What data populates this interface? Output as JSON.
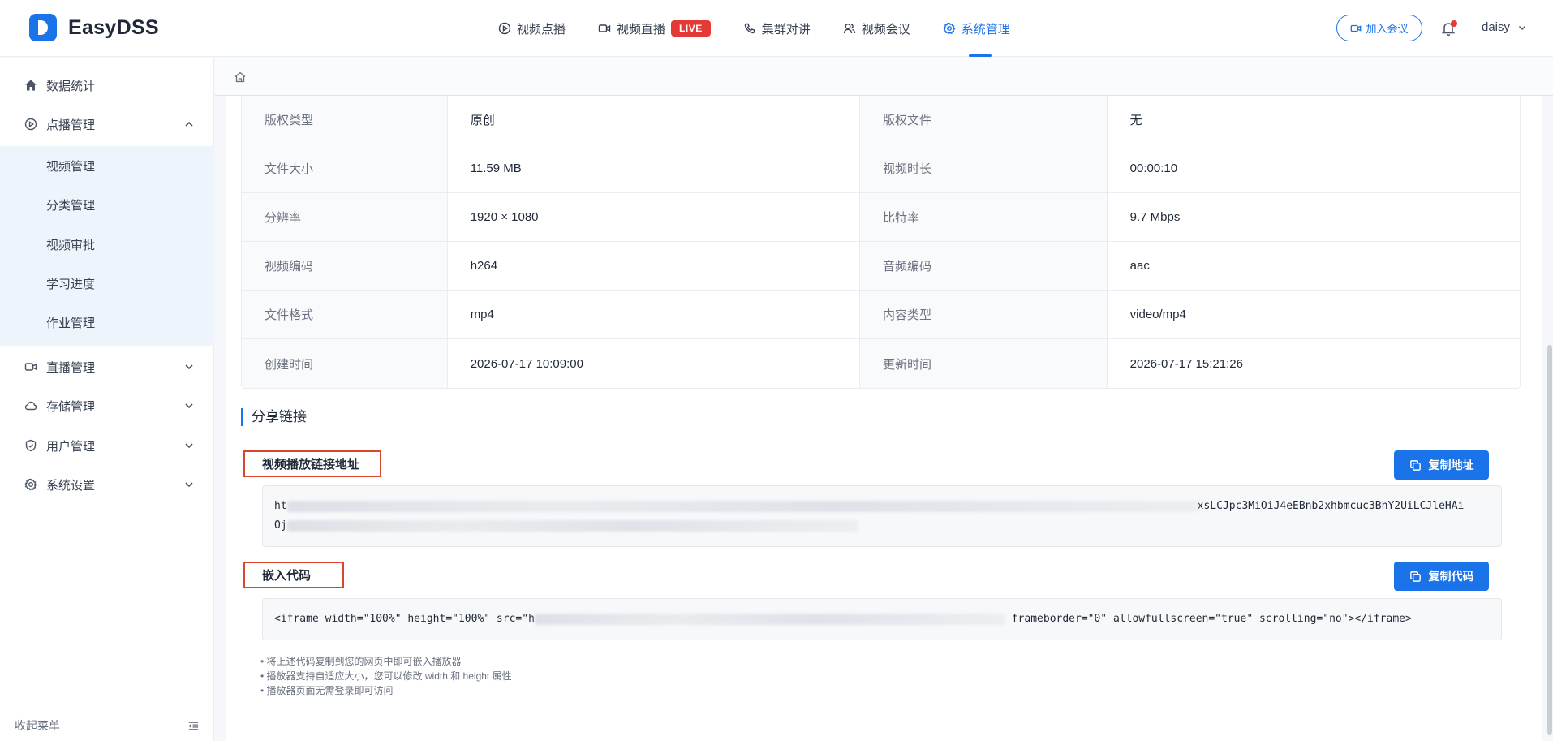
{
  "app": {
    "name": "EasyDSS"
  },
  "nav": [
    {
      "label": "视频点播",
      "icon": "play-circle-icon"
    },
    {
      "label": "视频直播",
      "icon": "video-camera-icon",
      "badge": "LIVE"
    },
    {
      "label": "集群对讲",
      "icon": "phone-icon"
    },
    {
      "label": "视频会议",
      "icon": "users-icon"
    },
    {
      "label": "系统管理",
      "icon": "gear-icon",
      "active": true
    }
  ],
  "header": {
    "join_label": "加入会议",
    "user": "daisy"
  },
  "sidebar": {
    "items": [
      {
        "label": "数据统计",
        "icon": "home-icon"
      },
      {
        "label": "点播管理",
        "icon": "play-circle-icon",
        "expanded": true
      },
      {
        "label": "直播管理",
        "icon": "video-camera-icon"
      },
      {
        "label": "存储管理",
        "icon": "cloud-icon"
      },
      {
        "label": "用户管理",
        "icon": "shield-icon"
      },
      {
        "label": "系统设置",
        "icon": "gear-icon"
      }
    ],
    "subitems": [
      "视频管理",
      "分类管理",
      "视频审批",
      "学习进度",
      "作业管理"
    ],
    "collapse_label": "收起菜单"
  },
  "info": {
    "rows": [
      {
        "l1": "版权类型",
        "v1": "原创",
        "l2": "版权文件",
        "v2": "无"
      },
      {
        "l1": "文件大小",
        "v1": "11.59 MB",
        "l2": "视频时长",
        "v2": "00:00:10"
      },
      {
        "l1": "分辨率",
        "v1": "1920 × 1080",
        "l2": "比特率",
        "v2": "9.7 Mbps"
      },
      {
        "l1": "视频编码",
        "v1": "h264",
        "l2": "音频编码",
        "v2": "aac"
      },
      {
        "l1": "文件格式",
        "v1": "mp4",
        "l2": "内容类型",
        "v2": "video/mp4"
      },
      {
        "l1": "创建时间",
        "v1": "2026-07-17 10:09:00",
        "l2": "更新时间",
        "v2": "2026-07-17 15:21:26"
      }
    ]
  },
  "share": {
    "title": "分享链接",
    "link": {
      "label": "视频播放链接地址",
      "copy_label": "复制地址",
      "line1_start": "ht",
      "line1_end": "xsLCJpc3MiOiJ4eEBnb2xhbmcuc3BhY2UiLCJleHAi",
      "line2_start": "Oj"
    },
    "embed": {
      "label": "嵌入代码",
      "copy_label": "复制代码",
      "code_start": "<iframe width=\"100%\" height=\"100%\" src=\"h",
      "code_end": " frameborder=\"0\" allowfullscreen=\"true\" scrolling=\"no\"></iframe>"
    },
    "notes": [
      "• 将上述代码复制到您的网页中即可嵌入播放器",
      "• 播放器支持自适应大小，您可以修改 width 和 height 属性",
      "• 播放器页面无需登录即可访问"
    ]
  }
}
